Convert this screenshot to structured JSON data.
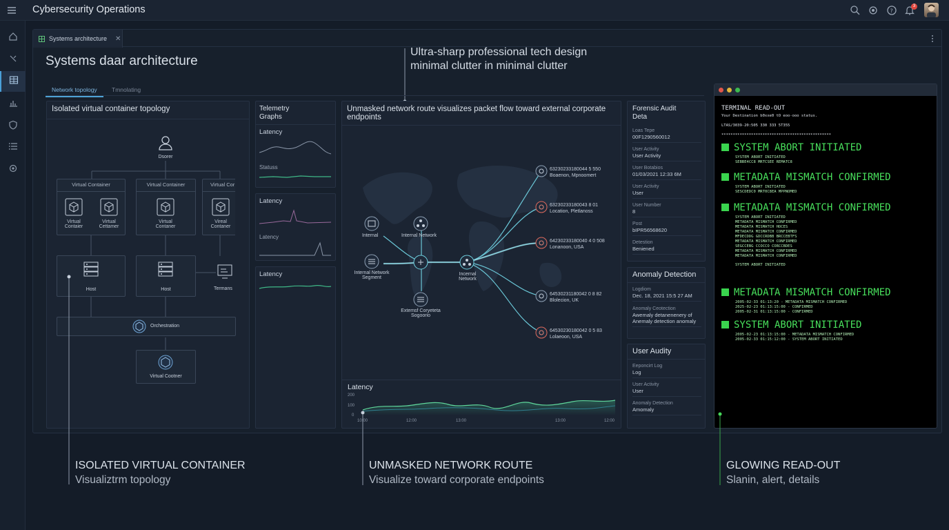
{
  "app": {
    "title": "Cybersecurity Operations",
    "notification_count": "3"
  },
  "document_tab": {
    "label": "Systems architecture"
  },
  "page": {
    "title": "Systems daar architecture",
    "subtabs": [
      "Network topology",
      "Tmnolating"
    ],
    "annotation_top": [
      "Ultra-sharp professional tech design",
      "minimal clutter in minimal clutter"
    ]
  },
  "topology": {
    "title": "Isolated virtual container topology",
    "user_label": "Dsorer",
    "containers": [
      {
        "title": "Virtual Container",
        "items": [
          "Virtual Contaier",
          "Virtual Cettamer"
        ]
      },
      {
        "title": "Virtual Container",
        "items": [
          "Virtual Contaner"
        ]
      },
      {
        "title": "Virtual Cor",
        "items": [
          "Vireal Contaner"
        ]
      }
    ],
    "hosts": [
      "Host",
      "Host"
    ],
    "terminal_label": "Termans",
    "orchestration": "Orchestration",
    "virtual_cootner": "Virtual Cootner"
  },
  "telemetry": {
    "title": "Telemetry Graphs",
    "blocks": [
      {
        "label": "Latency",
        "sub": "Statuss"
      },
      {
        "label": "Latency",
        "sub": "Latency"
      },
      {
        "label": "Latency",
        "sub": ""
      }
    ]
  },
  "network": {
    "title": "Unmasked network route visualizes packet flow toward external corporate endpoints",
    "nodes": {
      "internal": "Internal",
      "internal_network": "Internal Network",
      "internal_segment": "Internal Network Segment",
      "external_segment": "Extemsf Coryeteta Sogoorio",
      "core": "Incernal Network"
    },
    "endpoints": [
      {
        "id": "63230233180044 5 550",
        "loc": "Boaenon, Mpnoomert"
      },
      {
        "id": "63230233180043 8 01",
        "loc": "Location, Pletlanoss"
      },
      {
        "id": "64230233180040 4 0 508",
        "loc": "Lonanoon, USA"
      },
      {
        "id": "64530231180042 0 8 82",
        "loc": "Blolecion, UK"
      },
      {
        "id": "64530230180042 0 5 83",
        "loc": "Lolaeoon, USA"
      }
    ],
    "latency": {
      "label": "Latency",
      "y_ticks": [
        "200",
        "100",
        "0"
      ],
      "x_ticks": [
        "10:00",
        "12:00",
        "13:00",
        "13:00",
        "12:00"
      ]
    }
  },
  "forensic": {
    "title": "Forensic Audit Deta",
    "rows": [
      {
        "k": "Loas Tepe",
        "v": "00F1290560012"
      },
      {
        "k": "User Activity",
        "v": "User Activity"
      },
      {
        "k": "User Botabios",
        "v": "01/03/2021 12:33 6M"
      },
      {
        "k": "User Activity",
        "v": "User"
      },
      {
        "k": "User Number",
        "v": "8"
      },
      {
        "k": "Post",
        "v": "bIPR56568620"
      },
      {
        "k": "Detestion",
        "v": "Beniened"
      }
    ]
  },
  "anomaly": {
    "title": "Anomaly Detection",
    "rows": [
      {
        "k": "Logdiom",
        "v": "Dec. 18, 2021 15:5 27 AM"
      },
      {
        "k": "Anomaly Ceotection",
        "v": "Awemaly detanenenery of Anemaly detection anomaly"
      }
    ]
  },
  "user_audit": {
    "title": "User Audity",
    "rows": [
      {
        "k": "Eeponcirt Log",
        "v": "Log"
      },
      {
        "k": "User Activity",
        "v": "User"
      },
      {
        "k": "Anomaly Detection",
        "v": "Amomaly"
      }
    ]
  },
  "terminal": {
    "title": "TERMINAL READ-OUT",
    "lines_top": [
      "Your Destination b0xxe0 tO eoo-ooo status.",
      "LTAS/3039-20:505 330 333 5T355",
      "************************************************"
    ],
    "entries": [
      {
        "big": "SYSTEM ABORT INITIATED",
        "small": [
          "SYSTEM ABORT INITIATED",
          "SEBBE4CC8 MRTCSEE REMATC8"
        ]
      },
      {
        "big": "METADATA MISMATCH CONFIRMED",
        "small": [
          "SYSTEM ABORT INITIATED",
          "SESCDEDC0 MRT0C8EA MPPNOMED"
        ]
      },
      {
        "big": "METADATA MISMATCH CONFIRMED",
        "small": [
          "SYSTEM ABORT INITIATED",
          "METADATA MISMATCH CONFIRMED",
          "METADATA MISMATCH HOCES",
          "METADATA MISMATCH CONFIRMED",
          "MFDECDDG GDCCRDBB BRCCEBTFS",
          "METADATA MISMATCH CONFIRMED",
          "SEGCCEBG CCOCCO CORCCBDES",
          "METADATA MISMATCH CONFIRMED",
          "METADATA MISMATCH CONFIRMED",
          "SYSTEM ABORT INITIATED"
        ]
      },
      {
        "big": "METADATA MISMATCH CONFIRMED",
        "small": [
          "2005-02-33 01:13:20 - METADATA MISMATCH CONFIRMED",
          "2025-02-23 01:13:15:00 - CONFIRMED",
          "2005-02-31 01:13:15:00 - CONFIRMED"
        ]
      },
      {
        "big": "SYSTEM ABORT INITIATED",
        "small": [
          "2005-02-23 01:13:15:00 - METADATA MISMATCH CONFIRMED",
          "2005-02-33 01:15:12:00 - SYSTEM ABORT INITIATED"
        ]
      }
    ]
  },
  "annotations": [
    {
      "title": "ISOLATED VIRTUAL CONTAINER",
      "sub": "Visualiztrm topology"
    },
    {
      "title": "UNMASKED NETWORK ROUTE",
      "sub": "Visualize toward corporate endpoints"
    },
    {
      "title": "GLOWING READ-OUT",
      "sub": "Slanin, alert, details"
    }
  ],
  "icons": [
    "menu-icon",
    "search-icon",
    "gear-icon",
    "help-icon",
    "bell-icon",
    "avatar",
    "home-icon",
    "tools-icon",
    "grid-icon",
    "chart-icon",
    "shield-icon",
    "list-icon",
    "settings-icon"
  ]
}
